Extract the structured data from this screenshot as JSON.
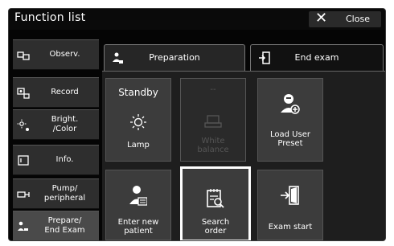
{
  "window": {
    "title": "Function list",
    "close_label": "Close"
  },
  "sidebar": {
    "items": [
      {
        "label": "Observ."
      },
      {
        "label": "Record"
      },
      {
        "label": "Bright.\n/Color"
      },
      {
        "label": "Info."
      },
      {
        "label": "Pump/\nperipheral"
      },
      {
        "label": "Prepare/\nEnd Exam"
      }
    ]
  },
  "tabs": [
    {
      "label": "Preparation"
    },
    {
      "label": "End exam"
    }
  ],
  "buttons": {
    "standby": {
      "label": "Standby"
    },
    "lamp": {
      "label": "Lamp"
    },
    "disabled_top": {
      "label": "--"
    },
    "white_balance": {
      "label": "White\nbalance"
    },
    "load_user_preset": {
      "label": "Load User\nPreset"
    },
    "enter_new_patient": {
      "label": "Enter new\npatient"
    },
    "search_order": {
      "label": "Search\norder"
    },
    "exam_start": {
      "label": "Exam start"
    }
  }
}
